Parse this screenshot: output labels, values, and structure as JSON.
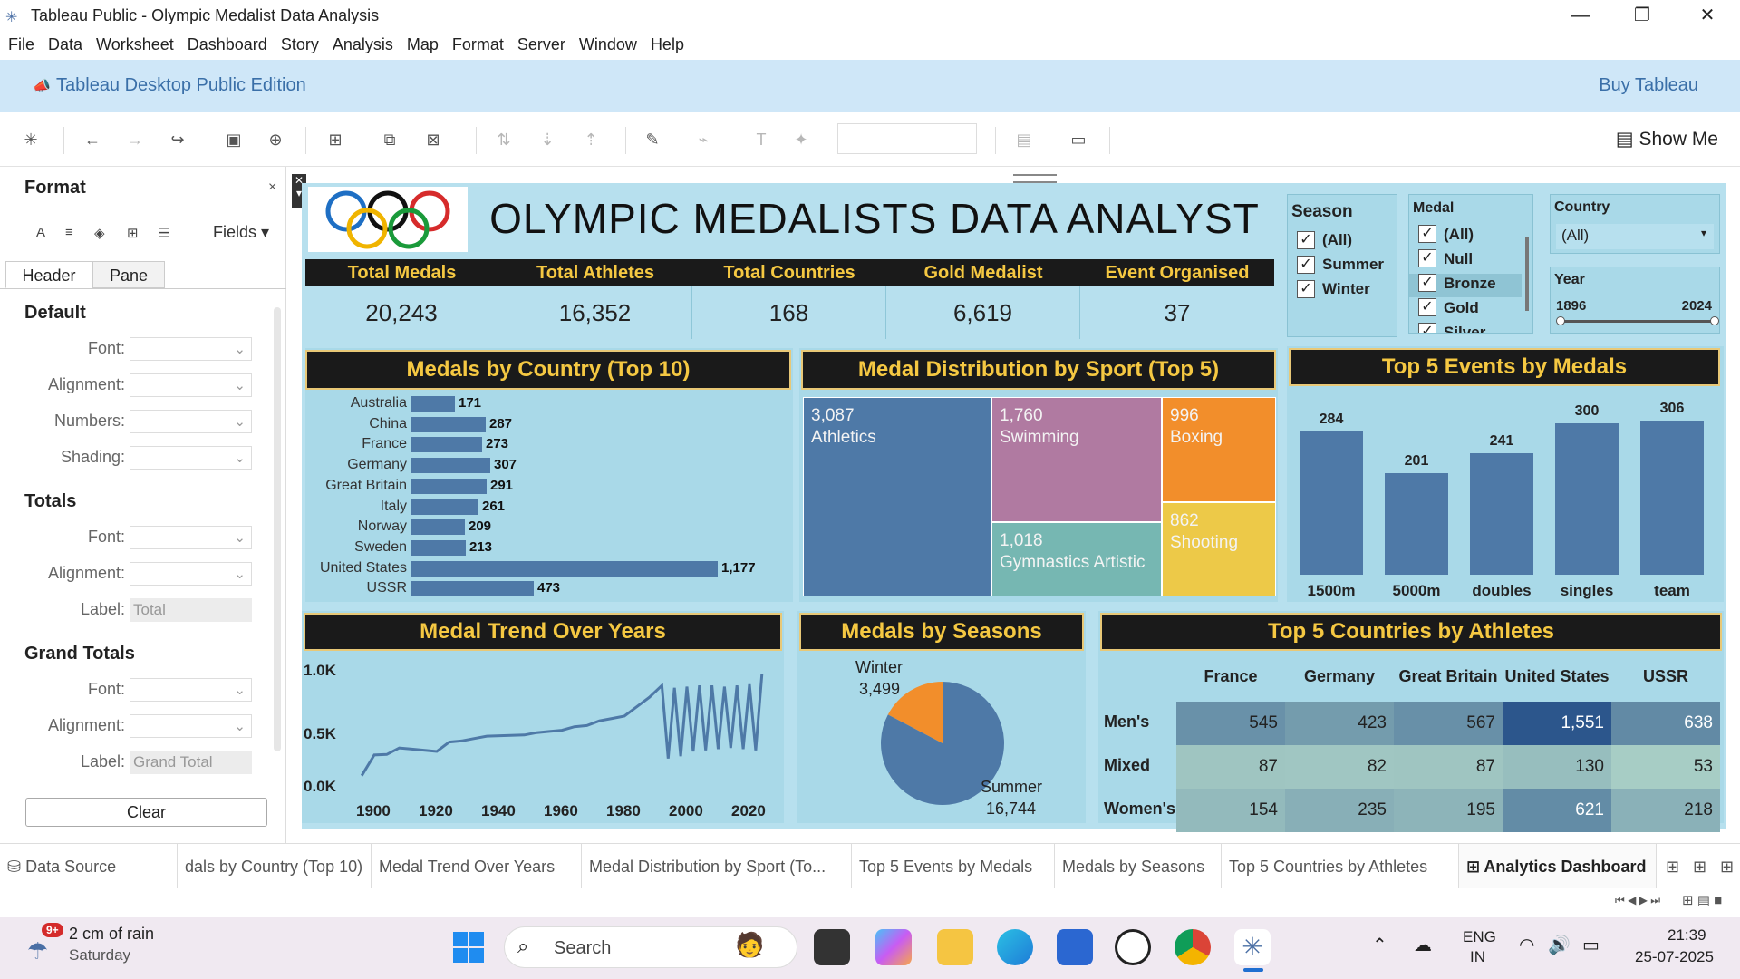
{
  "window": {
    "title": "Tableau Public - Olympic Medalist Data Analysis"
  },
  "menu": [
    "File",
    "Data",
    "Worksheet",
    "Dashboard",
    "Story",
    "Analysis",
    "Map",
    "Format",
    "Server",
    "Window",
    "Help"
  ],
  "banner": {
    "edition": "Tableau Desktop Public Edition",
    "buy": "Buy Tableau"
  },
  "toolbar": {
    "show_me": "Show Me"
  },
  "format_panel": {
    "title": "Format",
    "fields": "Fields",
    "tabs": [
      "Header",
      "Pane"
    ],
    "default": {
      "title": "Default",
      "font": "Font:",
      "alignment": "Alignment:",
      "numbers": "Numbers:",
      "shading": "Shading:"
    },
    "totals": {
      "title": "Totals",
      "font": "Font:",
      "alignment": "Alignment:",
      "label": "Label:",
      "label_value": "Total"
    },
    "grand_totals": {
      "title": "Grand Totals",
      "font": "Font:",
      "alignment": "Alignment:",
      "label": "Label:",
      "label_value": "Grand Total"
    },
    "clear": "Clear"
  },
  "dashboard": {
    "title": "OLYMPIC MEDALISTS DATA ANALYST",
    "kpis": [
      {
        "label": "Total Medals",
        "value": "20,243"
      },
      {
        "label": "Total Athletes",
        "value": "16,352"
      },
      {
        "label": "Total Countries",
        "value": "168"
      },
      {
        "label": "Gold Medalist",
        "value": "6,619"
      },
      {
        "label": "Event Organised",
        "value": "37"
      }
    ],
    "filters": {
      "season": {
        "title": "Season",
        "items": [
          "(All)",
          "Summer",
          "Winter"
        ]
      },
      "medal": {
        "title": "Medal",
        "items": [
          "(All)",
          "Null",
          "Bronze",
          "Gold",
          "Silver"
        ]
      },
      "country": {
        "title": "Country",
        "value": "(All)"
      },
      "year": {
        "title": "Year",
        "min": "1896",
        "max": "2024"
      }
    },
    "country_chart": {
      "title": "Medals by Country (Top 10)"
    },
    "sport_chart": {
      "title": "Medal Distribution by Sport (Top 5)"
    },
    "events_chart": {
      "title": "Top 5 Events by Medals"
    },
    "trend_chart": {
      "title": "Medal Trend Over Years",
      "ticks_y": [
        "1.0K",
        "0.5K",
        "0.0K"
      ],
      "ticks_x": [
        "1900",
        "1920",
        "1940",
        "1960",
        "1980",
        "2000",
        "2020"
      ]
    },
    "seasons_chart": {
      "title": "Medals by Seasons",
      "winter_label": "Winter",
      "winter_value": "3,499",
      "summer_label": "Summer",
      "summer_value": "16,744"
    },
    "athletes_table": {
      "title": "Top 5 Countries by Athletes"
    }
  },
  "chart_data": [
    {
      "type": "bar",
      "title": "Medals by Country (Top 10)",
      "categories": [
        "Australia",
        "China",
        "France",
        "Germany",
        "Great Britain",
        "Italy",
        "Norway",
        "Sweden",
        "United States",
        "USSR"
      ],
      "values": [
        171,
        287,
        273,
        307,
        291,
        261,
        209,
        213,
        1177,
        473
      ],
      "labels": [
        "171",
        "287",
        "273",
        "307",
        "291",
        "261",
        "209",
        "213",
        "1,177",
        "473"
      ]
    },
    {
      "type": "treemap",
      "title": "Medal Distribution by Sport (Top 5)",
      "categories": [
        "Athletics",
        "Swimming",
        "Boxing",
        "Gymnastics Artistic",
        "Shooting"
      ],
      "values": [
        3087,
        1760,
        996,
        1018,
        862
      ],
      "labels": [
        "3,087",
        "1,760",
        "996",
        "1,018",
        "862"
      ],
      "colors": [
        "#4e79a7",
        "#b07aa1",
        "#f28e2b",
        "#76b7b2",
        "#edc948"
      ]
    },
    {
      "type": "bar",
      "title": "Top 5 Events by Medals",
      "categories": [
        "1500m",
        "5000m",
        "doubles",
        "singles",
        "team"
      ],
      "values": [
        284,
        201,
        241,
        300,
        306
      ]
    },
    {
      "type": "line",
      "title": "Medal Trend Over Years",
      "ylim": [
        0,
        1000
      ],
      "x": [
        1896,
        1900,
        1904,
        1908,
        1912,
        1920,
        1924,
        1928,
        1932,
        1936,
        1948,
        1952,
        1956,
        1960,
        1964,
        1968,
        1972,
        1976,
        1980,
        1984,
        1988,
        1992,
        1994,
        1996,
        1998,
        2000,
        2002,
        2004,
        2006,
        2008,
        2010,
        2012,
        2014,
        2016,
        2018,
        2020,
        2022,
        2024
      ],
      "values": [
        95,
        270,
        275,
        330,
        320,
        300,
        380,
        390,
        410,
        430,
        440,
        460,
        470,
        480,
        510,
        520,
        560,
        580,
        600,
        680,
        760,
        860,
        240,
        840,
        260,
        850,
        300,
        860,
        310,
        860,
        320,
        850,
        330,
        860,
        320,
        870,
        310,
        960
      ]
    },
    {
      "type": "pie",
      "title": "Medals by Seasons",
      "categories": [
        "Winter",
        "Summer"
      ],
      "values": [
        3499,
        16744
      ],
      "colors": [
        "#f28e2b",
        "#4e79a7"
      ]
    },
    {
      "type": "table",
      "title": "Top 5 Countries by Athletes",
      "columns": [
        "France",
        "Germany",
        "Great Britain",
        "United States",
        "USSR"
      ],
      "rows": [
        {
          "label": "Men's",
          "values": [
            545,
            423,
            567,
            1551,
            638
          ],
          "labels": [
            "545",
            "423",
            "567",
            "1,551",
            "638"
          ]
        },
        {
          "label": "Mixed",
          "values": [
            87,
            82,
            87,
            130,
            53
          ],
          "labels": [
            "87",
            "82",
            "87",
            "130",
            "53"
          ]
        },
        {
          "label": "Women's",
          "values": [
            154,
            235,
            195,
            621,
            218
          ],
          "labels": [
            "154",
            "235",
            "195",
            "621",
            "218"
          ]
        }
      ]
    }
  ],
  "sheet_tabs": [
    "Data Source",
    "dals by Country (Top 10)",
    "Medal Trend Over Years",
    "Medal Distribution by Sport (To...",
    "Top 5 Events by Medals",
    "Medals by Seasons",
    "Top 5 Countries by Athletes",
    "Analytics Dashboard"
  ],
  "taskbar": {
    "weather": "2 cm of rain",
    "day": "Saturday",
    "badge": "9+",
    "search": "Search",
    "lang1": "ENG",
    "lang2": "IN",
    "time": "21:39",
    "date": "25-07-2025"
  }
}
